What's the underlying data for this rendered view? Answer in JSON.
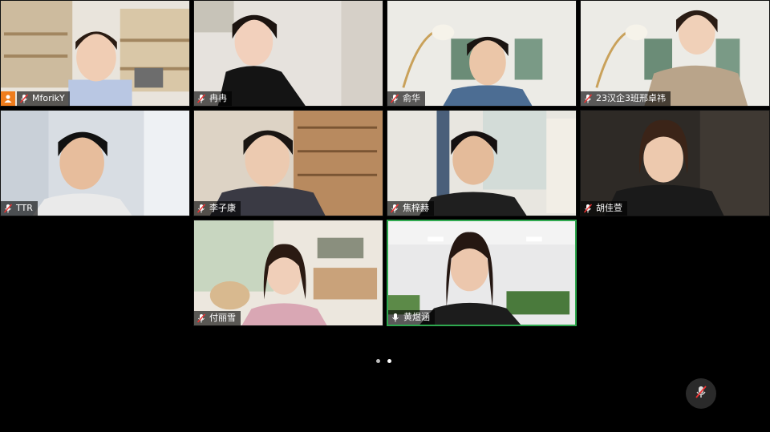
{
  "participants": [
    {
      "name": "MforikY",
      "host": true,
      "muted": true
    },
    {
      "name": "冉冉",
      "muted": true
    },
    {
      "name": "俞华",
      "muted": true
    },
    {
      "name": "23汉企3班邢卓祎",
      "muted": true
    },
    {
      "name": "TTR",
      "muted": true
    },
    {
      "name": "李子康",
      "muted": true
    },
    {
      "name": "焦梓赫",
      "muted": true
    },
    {
      "name": "胡佳萱",
      "muted": true
    },
    {
      "name": "付丽雪",
      "muted": true
    },
    {
      "name": "黄煜涵",
      "muted": false,
      "active_speaker": true
    }
  ],
  "pagination": {
    "pages": 2,
    "current": 2
  },
  "colors": {
    "background": "#000000",
    "active_speaker_border": "#2fa84f",
    "host_badge": "#ef7d1d"
  },
  "icons": {
    "muted": "mic-muted-icon",
    "unmuted": "mic-icon",
    "host": "person-icon",
    "floating": "mic-muted-icon"
  }
}
